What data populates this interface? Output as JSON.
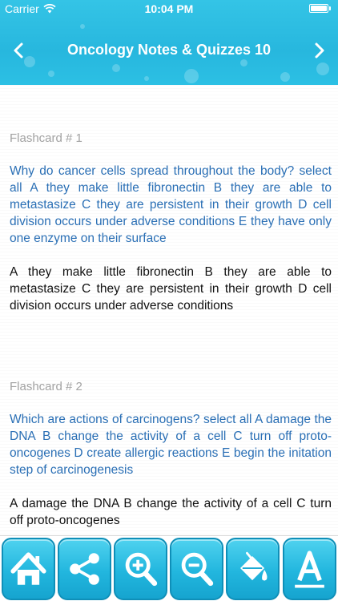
{
  "status_bar": {
    "carrier": "Carrier",
    "time": "10:04 PM"
  },
  "nav": {
    "title": "Oncology Notes & Quizzes 10",
    "back_icon": "chevron-left-icon",
    "forward_icon": "chevron-right-icon"
  },
  "flashcards": [
    {
      "label": "Flashcard # 1",
      "question": "Why do cancer cells spread throughout the body? select all A they make little fibronectin B they are able to metastasize C they are persistent in their growth D cell division occurs under adverse conditions E they have only one enzyme on their surface",
      "answer": "A they make little fibronectin B they are able to metastasize C they are persistent in their growth D cell division occurs under adverse conditions"
    },
    {
      "label": "Flashcard # 2",
      "question": "Which are actions of carcinogens? select all A damage the DNA B change the activity of a cell C turn off proto-oncogenes D create allergic reactions E begin the initation step of carcinogenesis",
      "answer": "A damage the DNA B change the activity of a cell C turn off proto-oncogenes"
    }
  ],
  "toolbar": {
    "items": [
      "home-icon",
      "share-icon",
      "zoom-in-icon",
      "zoom-out-icon",
      "paint-bucket-icon",
      "font-icon"
    ]
  },
  "colors": {
    "header": "#2cc0e4",
    "question_text": "#2a6fb5",
    "label_text": "#a2a2a2",
    "toolbar_button": "#22b6de"
  }
}
